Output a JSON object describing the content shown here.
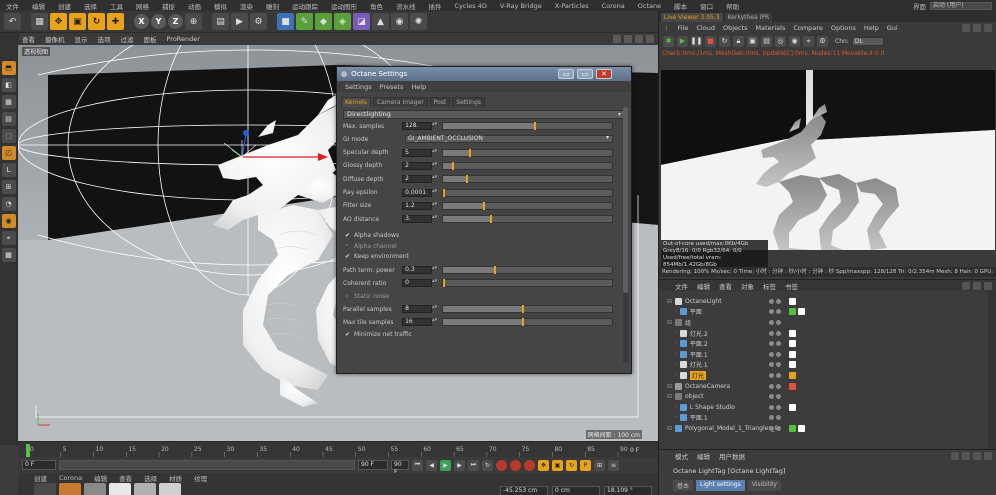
{
  "menubar": {
    "items": [
      "文件",
      "编辑",
      "创建",
      "选择",
      "工具",
      "网格",
      "捕捉",
      "动画",
      "模拟",
      "渲染",
      "雕刻",
      "运动跟踪",
      "运动图形",
      "角色",
      "流水线",
      "插件",
      "Cycles 4D",
      "V-Ray Bridge",
      "X-Particles",
      "Corona",
      "Octane",
      "脚本",
      "窗口",
      "帮助"
    ],
    "layout_label": "界面",
    "layout_value": "启动 (用户)"
  },
  "toolbar": {
    "undo": "↶",
    "live": "▦",
    "move": "✥",
    "scale": "▣",
    "rotate": "↻",
    "axis": "✚",
    "x": "X",
    "y": "Y",
    "z": "Z",
    "coord": "⊕",
    "render_region": "▤",
    "render_view": "▶",
    "render_settings": "⚙",
    "cube": "■",
    "pen": "✎",
    "subdiv": "◆",
    "array": "◈",
    "deform": "◪",
    "scene": "▲",
    "camera": "◉",
    "light": "✺"
  },
  "viewport": {
    "menu": [
      "查看",
      "摄像机",
      "显示",
      "选项",
      "过滤",
      "面板",
      "ProRender"
    ],
    "label": "透视视图",
    "scale_text": "网格间距 : 100 cm"
  },
  "timeline": {
    "ticks": [
      "0",
      "5",
      "10",
      "15",
      "20",
      "25",
      "30",
      "35",
      "40",
      "45",
      "50",
      "55",
      "60",
      "65",
      "70",
      "75",
      "80",
      "85",
      "90"
    ],
    "end_frame": "0 F"
  },
  "playbar": {
    "start": "0 F",
    "current": "0 F",
    "end": "90 F",
    "end2": "90 F"
  },
  "materials": {
    "tabs": [
      "创建",
      "Corona",
      "编辑",
      "查看",
      "选择",
      "材质",
      "纹理"
    ],
    "coords": [
      "-45.253 cm",
      "0 cm",
      "18.109 °"
    ]
  },
  "octane": {
    "title": "Octane Settings",
    "menu": [
      "Settings",
      "Presets",
      "Help"
    ],
    "tabs": [
      "Kernels",
      "Camera Imager",
      "Post",
      "Settings"
    ],
    "active_tab": "Kernels",
    "kernel": "Directlighting",
    "rows": [
      {
        "label": "Max. samples",
        "value": "128.",
        "fill": 0.53
      },
      {
        "label": "GI mode",
        "select": "GI_AMBIENT_OCCLUSION"
      },
      {
        "label": "Specular depth",
        "value": "5",
        "fill": 0.16
      },
      {
        "label": "Glossy depth",
        "value": "2",
        "fill": 0.06
      },
      {
        "label": "Diffuse depth",
        "value": "2",
        "fill": 0.14
      },
      {
        "label": "Ray epsilon",
        "value": "0.0001",
        "fill": 0.0
      },
      {
        "label": "Filter size",
        "value": "1.2",
        "fill": 0.24
      },
      {
        "label": "AO distance",
        "value": "3.",
        "fill": 0.28
      }
    ],
    "checks1": [
      {
        "label": "Alpha shadows",
        "checked": true
      },
      {
        "label": "Alpha channel",
        "checked": false
      },
      {
        "label": "Keep environment",
        "checked": true
      }
    ],
    "rows2": [
      {
        "label": "Path term. power",
        "value": "0.3",
        "fill": 0.3
      },
      {
        "label": "Coherent ratio",
        "value": "0",
        "fill": 0.0
      }
    ],
    "static_noise": {
      "label": "Static noise",
      "checked": false
    },
    "rows3": [
      {
        "label": "Parallel samples",
        "value": "8",
        "fill": 0.46
      },
      {
        "label": "Max tile samples",
        "value": "16",
        "fill": 0.46
      }
    ],
    "minimize": {
      "label": "Minimize net traffic",
      "checked": true
    }
  },
  "live": {
    "tabs": [
      "Live Viewer 3.05.3",
      "Kerkythea IPR"
    ],
    "menu": [
      "File",
      "Cloud",
      "Objects",
      "Materials",
      "Compare",
      "Options",
      "Help",
      "Gui"
    ],
    "chn_label": "Chn:",
    "chn_value": "DL",
    "status": "Check:0ms./1ms. MeshGen:0ms. Update[C]:0ms. Nodes:11 Movable:4 0 0",
    "info": [
      "Out-of-core used/max:0Kb/4Gb",
      "Grey8/16: 0/0        Rgb32/64: 0/0",
      "Used/free/total vram: 854Mb/1.42Gb/8Gb"
    ],
    "stats": "Rendering: 100%    Ms/sec: 0    Time: 小时 : 分钟 : 秒/小时 : 分钟 : 秒    Spp/maxspp: 128/128    Tri: 0/2.354m  Mesh: 8    Hair: 0    GPU:"
  },
  "objmgr": {
    "menu": [
      "文件",
      "编辑",
      "查看",
      "对象",
      "标签",
      "书签"
    ],
    "rows": [
      {
        "name": "OctaneLight",
        "indent": 0,
        "icon": "#d9d9d9",
        "tags": [
          "#ffffff"
        ]
      },
      {
        "name": "平面",
        "indent": 1,
        "icon": "#5b9bd5",
        "tags": [
          "#58c040",
          "#ffffff"
        ]
      },
      {
        "name": "组",
        "indent": 0,
        "icon": "#7a7a7a",
        "tags": []
      },
      {
        "name": "灯光.2",
        "indent": 1,
        "icon": "#d9d9d9",
        "tags": [
          "#ffffff"
        ]
      },
      {
        "name": "平面.2",
        "indent": 1,
        "icon": "#5b9bd5",
        "tags": [
          "#ffffff"
        ]
      },
      {
        "name": "平面.1",
        "indent": 1,
        "icon": "#5b9bd5",
        "tags": [
          "#ffffff"
        ]
      },
      {
        "name": "灯光.1",
        "indent": 1,
        "icon": "#d9d9d9",
        "tags": [
          "#ffffff"
        ]
      },
      {
        "name": "灯光",
        "indent": 1,
        "icon": "#d9d9d9",
        "tags": [
          "#e8a31a"
        ],
        "highlight": true
      },
      {
        "name": "OctaneCamera",
        "indent": 0,
        "icon": "#9a9a9a",
        "tags": [
          "#e05040"
        ]
      },
      {
        "name": "object",
        "indent": 0,
        "icon": "#7a7a7a",
        "tags": []
      },
      {
        "name": "L Shape Studio",
        "indent": 1,
        "icon": "#5b9bd5",
        "tags": [
          "#ffffff"
        ]
      },
      {
        "name": "平面.1",
        "indent": 1,
        "icon": "#5b9bd5",
        "tags": []
      },
      {
        "name": "Polygonal_Model_1_Triangles_0",
        "indent": 0,
        "icon": "#5b9bd5",
        "tags": [
          "#58c040",
          "#ffffff"
        ]
      }
    ]
  },
  "attr": {
    "menu": [
      "模式",
      "编辑",
      "用户数据"
    ],
    "title": "Octane LightTag [Octane LightTag]",
    "tabs": [
      "基本",
      "Light settings",
      "Visibility"
    ],
    "active_tab": "Light settings"
  }
}
